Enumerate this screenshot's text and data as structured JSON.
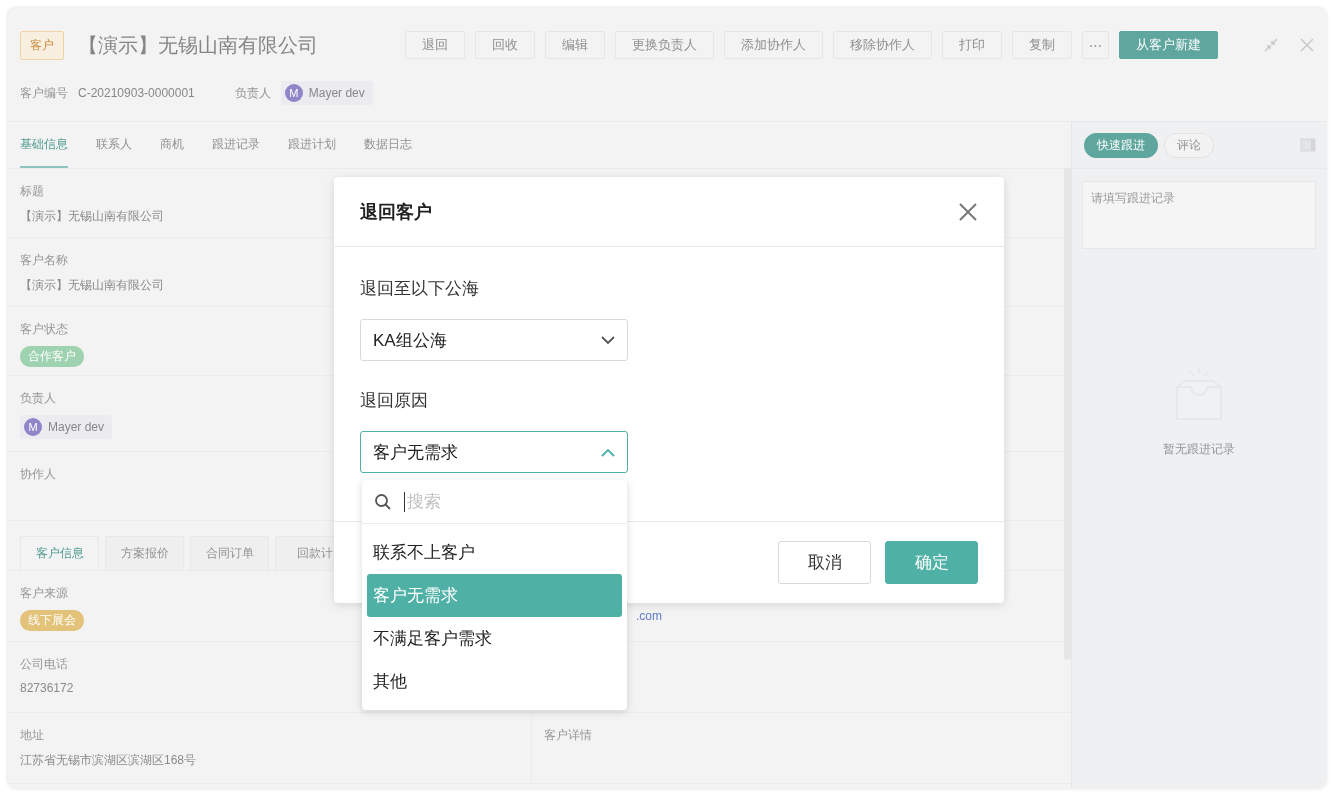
{
  "header": {
    "badge": "客户",
    "title": "【演示】无锡山南有限公司",
    "actions": [
      {
        "label": "退回",
        "kind": "default"
      },
      {
        "label": "回收",
        "kind": "default"
      },
      {
        "label": "编辑",
        "kind": "default"
      },
      {
        "label": "更换负责人",
        "kind": "default"
      },
      {
        "label": "添加协作人",
        "kind": "default"
      },
      {
        "label": "移除协作人",
        "kind": "default"
      },
      {
        "label": "打印",
        "kind": "default"
      },
      {
        "label": "复制",
        "kind": "default"
      },
      {
        "label": "⋯",
        "kind": "more"
      },
      {
        "label": "从客户新建",
        "kind": "primary"
      }
    ]
  },
  "meta": [
    {
      "label": "客户编号",
      "value": "C-20210903-0000001",
      "kind": "text"
    },
    {
      "label": "负责人",
      "value": "Mayer dev",
      "avatar": "M",
      "kind": "user"
    }
  ],
  "tabs": [
    {
      "label": "基础信息",
      "selected": true
    },
    {
      "label": "联系人",
      "selected": false
    },
    {
      "label": "商机",
      "selected": false
    },
    {
      "label": "跟进记录",
      "selected": false
    },
    {
      "label": "跟进计划",
      "selected": false
    },
    {
      "label": "数据日志",
      "selected": false
    }
  ],
  "fields": [
    {
      "label": "标题",
      "value": "【演示】无锡山南有限公司",
      "kind": "text"
    },
    {
      "label": "客户名称",
      "value": "【演示】无锡山南有限公司",
      "kind": "text"
    },
    {
      "label": "客户状态",
      "value": "合作客户",
      "kind": "tag",
      "color": "#9fd2b1"
    },
    {
      "label": "负责人",
      "value": "Mayer dev",
      "avatar": "M",
      "kind": "user"
    },
    {
      "label": "协作人",
      "kind": "text"
    }
  ],
  "detail_tabs": [
    {
      "label": "客户信息",
      "selected": true
    },
    {
      "label": "方案报价",
      "selected": false
    },
    {
      "label": "合同订单",
      "selected": false
    },
    {
      "label": "回款计",
      "selected": false
    }
  ],
  "detail_rows": [
    {
      "left": {
        "label": "客户来源",
        "value": "线下展会",
        "kind": "tag",
        "color": "#e3c27a"
      },
      "right": {
        "value": ".com",
        "kind": "link"
      }
    },
    {
      "left": {
        "label": "公司电话",
        "value": "82736172",
        "kind": "text"
      }
    },
    {
      "left": {
        "label": "地址",
        "value": "江苏省无锡市滨湖区滨湖区168号",
        "kind": "text"
      },
      "right": {
        "label": "客户详情"
      }
    }
  ],
  "side": {
    "tabs": [
      {
        "label": "快速跟进",
        "selected": true
      },
      {
        "label": "评论",
        "selected": false
      }
    ],
    "placeholder": "请填写跟进记录",
    "empty_text": "暂无跟进记录"
  },
  "modal": {
    "title": "退回客户",
    "fields": [
      {
        "label": "退回至以下公海",
        "value": "KA组公海",
        "expanded": false
      },
      {
        "label": "退回原因",
        "value": "客户无需求",
        "expanded": true
      }
    ],
    "buttons": [
      {
        "label": "取消",
        "kind": "default"
      },
      {
        "label": "确定",
        "kind": "primary"
      }
    ],
    "dropdown": {
      "placeholder": "搜索",
      "options": [
        {
          "label": "联系不上客户",
          "selected": false
        },
        {
          "label": "客户无需求",
          "selected": true
        },
        {
          "label": "不满足客户需求",
          "selected": false
        },
        {
          "label": "其他",
          "selected": false
        }
      ]
    }
  }
}
